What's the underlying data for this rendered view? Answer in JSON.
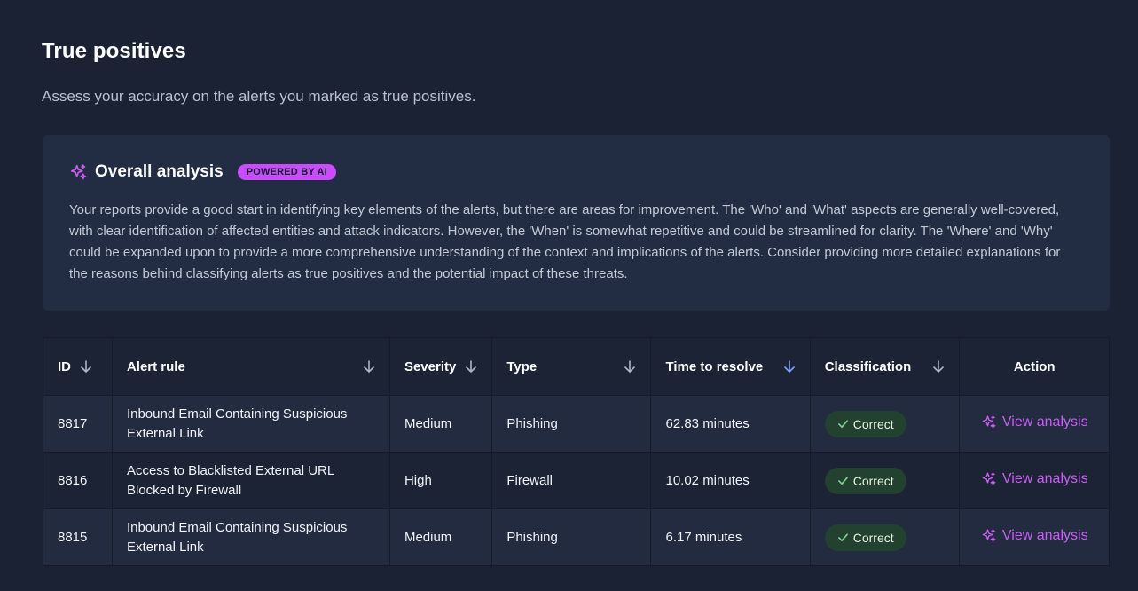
{
  "header": {
    "title": "True positives",
    "subtitle": "Assess your accuracy on the alerts you marked as true positives."
  },
  "analysis": {
    "title": "Overall analysis",
    "badge": "POWERED BY AI",
    "text": "Your reports provide a good start in identifying key elements of the alerts, but there are areas for improvement. The 'Who' and 'What' aspects are generally well-covered, with clear identification of affected entities and attack indicators. However, the 'When' is somewhat repetitive and could be streamlined for clarity. The 'Where' and 'Why' could be expanded upon to provide a more comprehensive understanding of the context and implications of the alerts. Consider providing more detailed explanations for the reasons behind classifying alerts as true positives and the potential impact of these threats."
  },
  "table": {
    "columns": {
      "id": "ID",
      "rule": "Alert rule",
      "severity": "Severity",
      "type": "Type",
      "time": "Time to resolve",
      "classification": "Classification",
      "action": "Action"
    },
    "rows": [
      {
        "id": "8817",
        "rule": "Inbound Email Containing Suspicious External Link",
        "severity": "Medium",
        "type": "Phishing",
        "time": "62.83 minutes",
        "classification": "Correct",
        "action": "View analysis"
      },
      {
        "id": "8816",
        "rule": "Access to Blacklisted External URL Blocked by Firewall",
        "severity": "High",
        "type": "Firewall",
        "time": "10.02 minutes",
        "classification": "Correct",
        "action": "View analysis"
      },
      {
        "id": "8815",
        "rule": "Inbound Email Containing Suspicious External Link",
        "severity": "Medium",
        "type": "Phishing",
        "time": "6.17 minutes",
        "classification": "Correct",
        "action": "View analysis"
      }
    ]
  },
  "colors": {
    "background": "#1b2234",
    "accent_purple": "#c95ff2",
    "active_sort": "#7aa2f7",
    "severity_medium": "#7aa2f7",
    "severity_high": "#f5b94a",
    "correct_badge": "#22412e"
  },
  "icons": {
    "analysis": "sparkle-icon",
    "sort": "arrow-down-icon",
    "correct": "check-icon",
    "view": "sparkle-icon"
  }
}
